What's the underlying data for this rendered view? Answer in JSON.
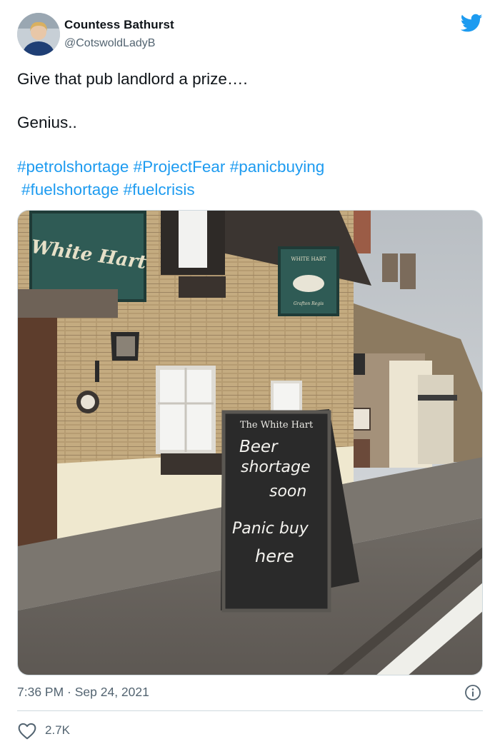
{
  "author": {
    "name": "Countess Bathurst",
    "handle": "@CotswoldLadyB"
  },
  "tweet": {
    "line1": "Give that pub landlord a prize….",
    "line2": "Genius..",
    "hashtags_row1": [
      "#petrolshortage",
      "#ProjectFear",
      "#panicbuying"
    ],
    "hashtags_row2": [
      "#fuelshortage",
      "#fuelcrisis"
    ]
  },
  "photo": {
    "pub_sign": "White Hart",
    "hanging_sign": "WHITE HART",
    "hanging_sign_sub": "Grafton Regis",
    "board_header": "The White Hart",
    "board_lines": [
      "Beer",
      "shortage",
      "soon",
      "Panic buy",
      "here"
    ]
  },
  "footer": {
    "timestamp": "7:36 PM · Sep 24, 2021",
    "like_count": "2.7K"
  },
  "colors": {
    "brand": "#1d9bf0",
    "muted": "#536471",
    "text": "#0f1419"
  }
}
